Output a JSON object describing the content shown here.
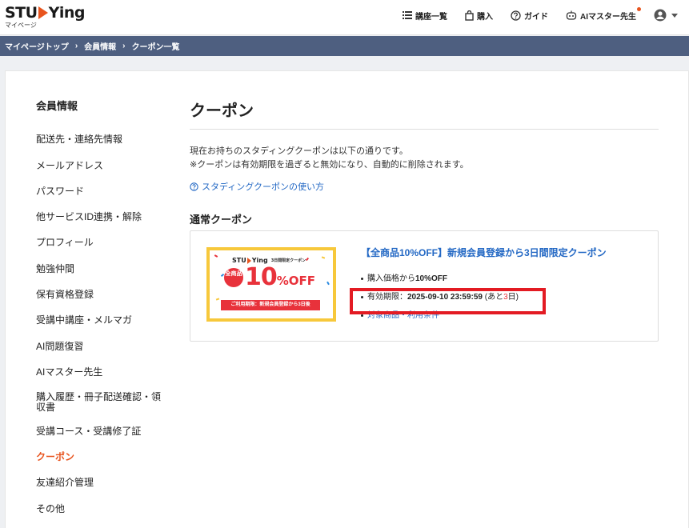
{
  "header": {
    "logo_text_left": "STU",
    "logo_text_right": "Ying",
    "logo_sub": "マイページ",
    "nav": {
      "courses": "講座一覧",
      "purchase": "購入",
      "guide": "ガイド",
      "ai_master": "AIマスター先生"
    }
  },
  "breadcrumb": [
    "マイページトップ",
    "会員情報",
    "クーポン一覧"
  ],
  "sidebar": {
    "title": "会員情報",
    "items": [
      "配送先・連絡先情報",
      "メールアドレス",
      "パスワード",
      "他サービスID連携・解除",
      "プロフィール",
      "勉強仲間",
      "保有資格登録",
      "受講中講座・メルマガ",
      "AI問題復習",
      "AIマスター先生",
      "購入履歴・冊子配送確認・領",
      "収書",
      "受講コース・受講修了証",
      "クーポン",
      "友達紹介管理",
      "その他"
    ]
  },
  "main": {
    "title": "クーポン",
    "desc_line1": "現在お持ちのスタディングクーポンは以下の通りです。",
    "desc_line2": "※クーポンは有効期限を過ぎると無効になり、自動的に削除されます。",
    "howto_link": "スタディングクーポンの使い方",
    "section_title": "通常クーポン"
  },
  "coupon": {
    "image": {
      "brand_left": "STU",
      "brand_right": "Ying",
      "brand_tag": "3日間限定クーポン",
      "badge": "全商品",
      "big_num": "10",
      "big_unit": "%OFF",
      "strip": "ご利用期限：新規会員登録から3日後"
    },
    "title": "【全商品10%OFF】新規会員登録から3日間限定クーポン",
    "price_prefix": "購入価格から",
    "price_value": "10%OFF",
    "expiry_label": "有効期限：",
    "expiry_datetime": "2025-09-10 23:59:59",
    "expiry_paren_open": " (あと",
    "expiry_days": "3",
    "expiry_paren_close": "日)",
    "terms_link": "対象商品・利用条件"
  },
  "colors": {
    "accent": "#e8541e",
    "link": "#2368c4",
    "breadcrumb_bg": "#4e5f80",
    "highlight": "#e31b23"
  }
}
